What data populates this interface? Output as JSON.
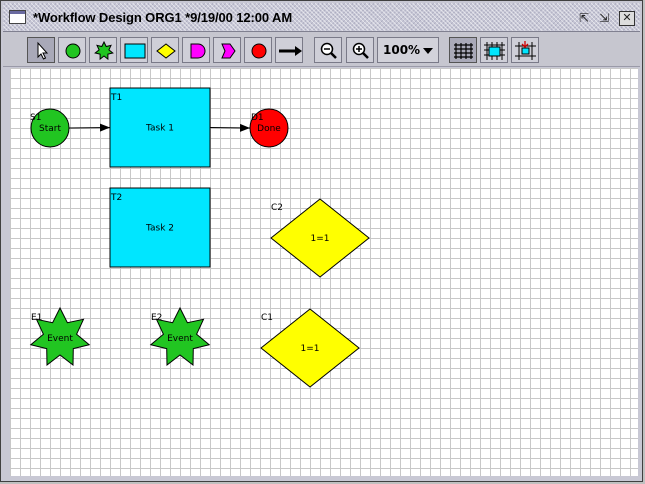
{
  "window": {
    "title": "*Workflow Design ORG1 *9/19/00 12:00 AM",
    "controls": {
      "minimize": "⇱",
      "maximize": "⇲",
      "close": "✕"
    }
  },
  "toolbar": {
    "tools": [
      {
        "name": "select-tool",
        "icon": "pointer-arrow-icon",
        "selected": true
      },
      {
        "name": "start-node-tool",
        "icon": "green-circle-icon",
        "color": "#21c521"
      },
      {
        "name": "event-node-tool",
        "icon": "green-star-icon",
        "color": "#21c521"
      },
      {
        "name": "task-node-tool",
        "icon": "cyan-rectangle-icon",
        "color": "#00e6ff"
      },
      {
        "name": "condition-node-tool",
        "icon": "yellow-diamond-icon",
        "color": "#ffff00"
      },
      {
        "name": "subprocess-node-tool",
        "icon": "magenta-d-shape-icon",
        "color": "#ff00ff"
      },
      {
        "name": "split-node-tool",
        "icon": "magenta-pentagon-icon",
        "color": "#ff00ff"
      },
      {
        "name": "end-node-tool",
        "icon": "red-circle-icon",
        "color": "#ff0000"
      },
      {
        "name": "connector-tool",
        "icon": "arrow-right-icon"
      }
    ],
    "zoom_out": "zoom-out-icon",
    "zoom_in": "zoom-in-icon",
    "zoom_value": "100%",
    "grid_tools": [
      {
        "name": "show-grid-tool",
        "icon": "grid-icon"
      },
      {
        "name": "snap-grid-tool",
        "icon": "grid-snap-icon"
      },
      {
        "name": "align-grid-tool",
        "icon": "grid-align-icon"
      }
    ]
  },
  "diagram": {
    "colors": {
      "start": "#21c521",
      "event": "#21c521",
      "task": "#00e6ff",
      "condition": "#ffff00",
      "end": "#ff0000"
    },
    "nodes": [
      {
        "id": "S1",
        "type": "start",
        "text": "Start",
        "id_label": "S1"
      },
      {
        "id": "T1",
        "type": "task",
        "text": "Task 1",
        "id_label": "T1"
      },
      {
        "id": "D1",
        "type": "end",
        "text": "Done",
        "id_label": "D1"
      },
      {
        "id": "T2",
        "type": "task",
        "text": "Task 2",
        "id_label": "T2"
      },
      {
        "id": "C2",
        "type": "condition",
        "text": "1=1",
        "id_label": "C2"
      },
      {
        "id": "E1",
        "type": "event",
        "text": "Event",
        "id_label": "E1"
      },
      {
        "id": "E2",
        "type": "event",
        "text": "Event",
        "id_label": "E2"
      },
      {
        "id": "C1",
        "type": "condition",
        "text": "1=1",
        "id_label": "C1"
      }
    ],
    "edges": [
      {
        "from": "S1",
        "to": "T1"
      },
      {
        "from": "T1",
        "to": "D1"
      }
    ]
  }
}
